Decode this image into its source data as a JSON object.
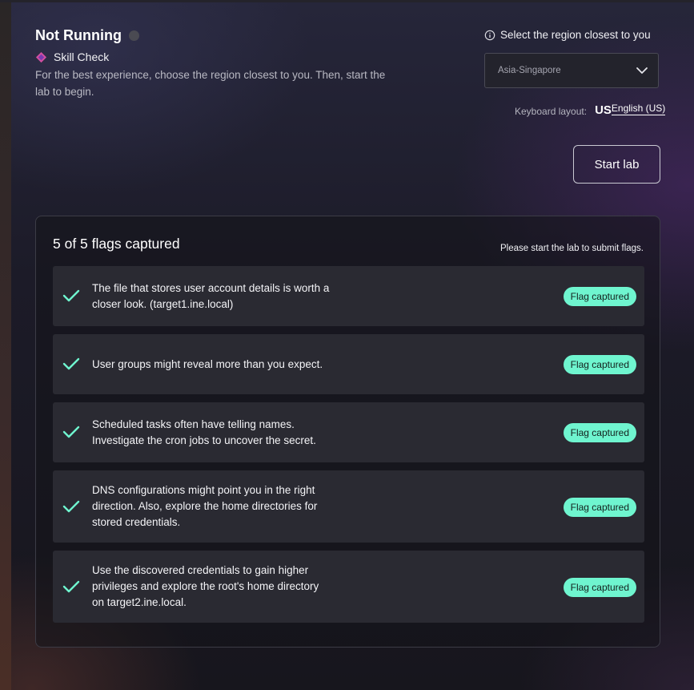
{
  "lab": {
    "status_title": "Not Running",
    "type_label": "Skill Check",
    "description": "For the best experience, choose the region closest to you. Then, start the lab to begin.",
    "start_button": "Start lab"
  },
  "region": {
    "label": "Select the region closest to you",
    "selected": "Asia-Singapore"
  },
  "keyboard": {
    "label": "Keyboard layout:",
    "code": "US",
    "name": "English (US)"
  },
  "flags": {
    "summary": "5 of 5 flags captured",
    "note": "Please start the lab to submit flags.",
    "items": [
      {
        "text": "The file that stores user account details is worth a closer look. (target1.ine.local)",
        "status": "Flag captured"
      },
      {
        "text": "User groups might reveal more than you expect.",
        "status": "Flag captured"
      },
      {
        "text": "Scheduled tasks often have telling names. Investigate the cron jobs to uncover the secret.",
        "status": "Flag captured"
      },
      {
        "text": "DNS configurations might point you in the right direction. Also, explore the home directories for stored credentials.",
        "status": "Flag captured"
      },
      {
        "text": "Use the discovered credentials to gain higher privileges and explore the root's home directory on target2.ine.local.",
        "status": "Flag captured"
      }
    ]
  },
  "colors": {
    "accent_green": "#6ff5cf",
    "skill_icon": "#d14fa0"
  }
}
